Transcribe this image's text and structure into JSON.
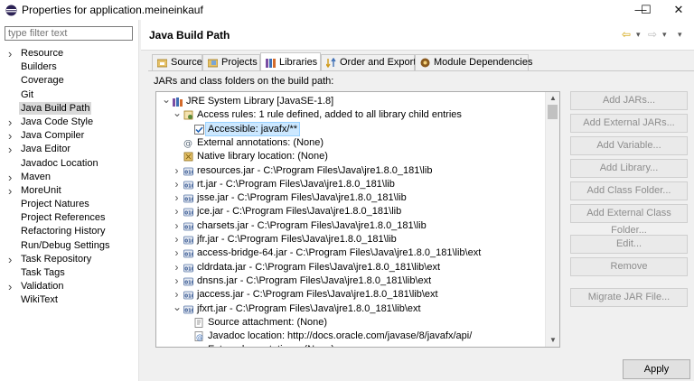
{
  "window": {
    "title": "Properties for application.meineinkauf",
    "controls": [
      "—",
      "☐",
      "✕"
    ]
  },
  "filter": {
    "placeholder": "type filter text"
  },
  "nav": {
    "items": [
      {
        "label": "Resource",
        "expandable": true
      },
      {
        "label": "Builders",
        "expandable": false
      },
      {
        "label": "Coverage",
        "expandable": false
      },
      {
        "label": "Git",
        "expandable": false
      },
      {
        "label": "Java Build Path",
        "expandable": false,
        "selected": true
      },
      {
        "label": "Java Code Style",
        "expandable": true
      },
      {
        "label": "Java Compiler",
        "expandable": true
      },
      {
        "label": "Java Editor",
        "expandable": true
      },
      {
        "label": "Javadoc Location",
        "expandable": false
      },
      {
        "label": "Maven",
        "expandable": true
      },
      {
        "label": "MoreUnit",
        "expandable": true
      },
      {
        "label": "Project Natures",
        "expandable": false
      },
      {
        "label": "Project References",
        "expandable": false
      },
      {
        "label": "Refactoring History",
        "expandable": false
      },
      {
        "label": "Run/Debug Settings",
        "expandable": false
      },
      {
        "label": "Task Repository",
        "expandable": true
      },
      {
        "label": "Task Tags",
        "expandable": false
      },
      {
        "label": "Validation",
        "expandable": true
      },
      {
        "label": "WikiText",
        "expandable": false
      }
    ]
  },
  "page": {
    "title": "Java Build Path",
    "back_glyph": "⇦",
    "forward_glyph": "⇨",
    "dropdown_glyph": "▾",
    "menu_glyph": "▾"
  },
  "tabs": [
    {
      "label": "Source",
      "active": false
    },
    {
      "label": "Projects",
      "active": false
    },
    {
      "label": "Libraries",
      "active": true
    },
    {
      "label": "Order and Export",
      "active": false
    },
    {
      "label": "Module Dependencies",
      "active": false
    }
  ],
  "libraries": {
    "label": "JARs and class folders on the build path:",
    "tree": [
      {
        "text": "JRE System Library [JavaSE-1.8]",
        "level": 0,
        "twisty": "open",
        "icon": "library-icon"
      },
      {
        "text": "Access rules: 1 rule defined, added to all library child entries",
        "level": 1,
        "twisty": "open",
        "icon": "access-rules-icon"
      },
      {
        "text": "Accessible: javafx/**",
        "level": 2,
        "twisty": "none",
        "icon": "checkmark-icon",
        "selected": true
      },
      {
        "text": "External annotations: (None)",
        "level": 1,
        "twisty": "none",
        "icon": "annotation-icon"
      },
      {
        "text": "Native library location: (None)",
        "level": 1,
        "twisty": "none",
        "icon": "native-library-icon"
      },
      {
        "text": "resources.jar - C:\\Program Files\\Java\\jre1.8.0_181\\lib",
        "level": 1,
        "twisty": "closed",
        "icon": "jar-icon"
      },
      {
        "text": "rt.jar - C:\\Program Files\\Java\\jre1.8.0_181\\lib",
        "level": 1,
        "twisty": "closed",
        "icon": "jar-icon"
      },
      {
        "text": "jsse.jar - C:\\Program Files\\Java\\jre1.8.0_181\\lib",
        "level": 1,
        "twisty": "closed",
        "icon": "jar-icon"
      },
      {
        "text": "jce.jar - C:\\Program Files\\Java\\jre1.8.0_181\\lib",
        "level": 1,
        "twisty": "closed",
        "icon": "jar-icon"
      },
      {
        "text": "charsets.jar - C:\\Program Files\\Java\\jre1.8.0_181\\lib",
        "level": 1,
        "twisty": "closed",
        "icon": "jar-icon"
      },
      {
        "text": "jfr.jar - C:\\Program Files\\Java\\jre1.8.0_181\\lib",
        "level": 1,
        "twisty": "closed",
        "icon": "jar-icon"
      },
      {
        "text": "access-bridge-64.jar - C:\\Program Files\\Java\\jre1.8.0_181\\lib\\ext",
        "level": 1,
        "twisty": "closed",
        "icon": "jar-icon"
      },
      {
        "text": "cldrdata.jar - C:\\Program Files\\Java\\jre1.8.0_181\\lib\\ext",
        "level": 1,
        "twisty": "closed",
        "icon": "jar-icon"
      },
      {
        "text": "dnsns.jar - C:\\Program Files\\Java\\jre1.8.0_181\\lib\\ext",
        "level": 1,
        "twisty": "closed",
        "icon": "jar-icon"
      },
      {
        "text": "jaccess.jar - C:\\Program Files\\Java\\jre1.8.0_181\\lib\\ext",
        "level": 1,
        "twisty": "closed",
        "icon": "jar-icon"
      },
      {
        "text": "jfxrt.jar - C:\\Program Files\\Java\\jre1.8.0_181\\lib\\ext",
        "level": 1,
        "twisty": "open",
        "icon": "jar-icon"
      },
      {
        "text": "Source attachment: (None)",
        "level": 2,
        "twisty": "none",
        "icon": "source-attachment-icon"
      },
      {
        "text": "Javadoc location: http://docs.oracle.com/javase/8/javafx/api/",
        "level": 2,
        "twisty": "none",
        "icon": "javadoc-icon"
      },
      {
        "text": "External annotations: (None)",
        "level": 2,
        "twisty": "none",
        "icon": "annotation-icon"
      }
    ]
  },
  "buttons": {
    "add_jars": "Add JARs...",
    "add_external_jars": "Add External JARs...",
    "add_variable": "Add Variable...",
    "add_library": "Add Library...",
    "add_class_folder": "Add Class Folder...",
    "add_external_class_folder": "Add External Class Folder...",
    "edit": "Edit...",
    "remove": "Remove",
    "migrate_jar": "Migrate JAR File...",
    "apply": "Apply"
  },
  "colors": {
    "selection": "#cce8ff",
    "disabled_text": "#8d8d8d",
    "panel_bg": "#f0f0f0"
  }
}
